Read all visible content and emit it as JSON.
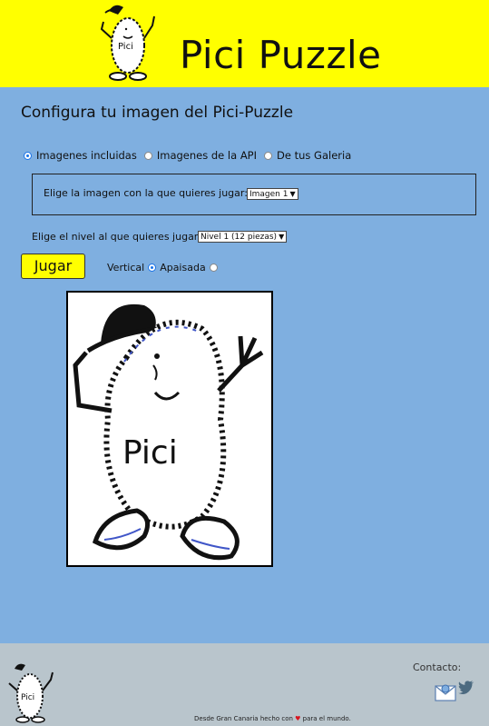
{
  "header": {
    "title": "Pici Puzzle",
    "logo_text": "Pici"
  },
  "main": {
    "page_title": "Configura tu imagen del Pici-Puzzle",
    "source_options": [
      {
        "label": "Imagenes incluidas",
        "checked": true
      },
      {
        "label": "Imagenes de la API",
        "checked": false
      },
      {
        "label": "De tus Galeria",
        "checked": false
      }
    ],
    "image_prompt": "Elige la imagen con la que quieres jugar:",
    "image_select_value": "Imagen 1",
    "level_prompt": "Elige el nivel al que quieres jugar:",
    "level_select_value": "Nivel 1 (12 piezas)",
    "play_label": "Jugar",
    "orientation_options": [
      {
        "label": "Vertical",
        "checked": true
      },
      {
        "label": "Apaisada",
        "checked": false
      }
    ],
    "preview_text": "Pici"
  },
  "footer": {
    "contact_label": "Contacto:",
    "credit_prefix": "Desde Gran Canaria hecho con",
    "credit_suffix": "para el mundo.",
    "icons": [
      "mail-icon",
      "twitter-icon"
    ]
  },
  "colors": {
    "header_bg": "#ffff00",
    "main_bg": "#7fafe0",
    "footer_bg": "#b9c5cc",
    "accent": "#1a73e8"
  }
}
